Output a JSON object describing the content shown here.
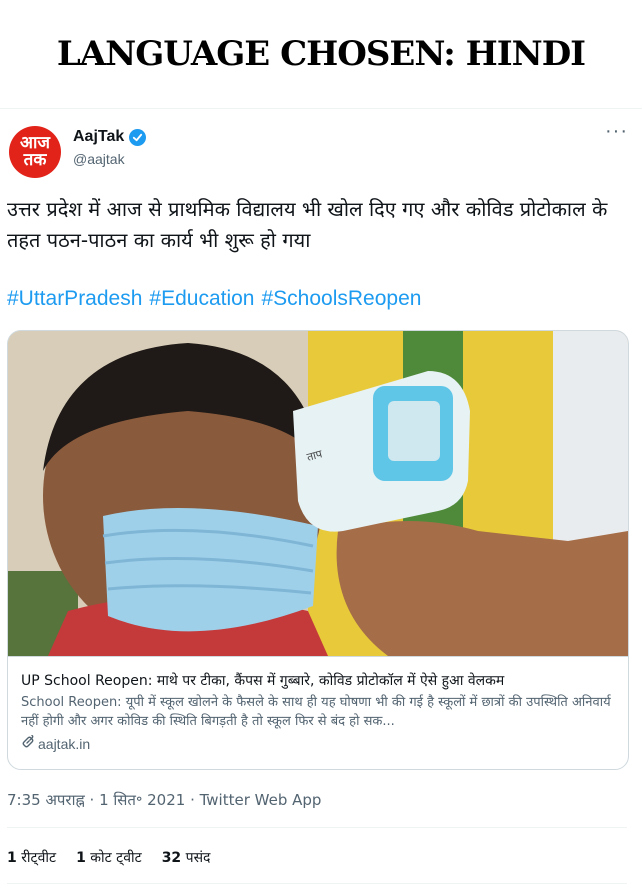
{
  "banner": {
    "title": "LANGUAGE CHOSEN: HINDI"
  },
  "author": {
    "avatar_text": "आज\nतक",
    "name": "AajTak",
    "handle": "@aajtak",
    "verified": true,
    "brand_color": "#e2231a"
  },
  "tweet": {
    "more_label": "···",
    "text": "उत्तर प्रदेश में आज से प्राथमिक विद्यालय भी खोल दिए गए और कोविड प्रोटोकाल के तहत पठन-पाठन का कार्य भी शुरू हो गया",
    "hashtags": [
      "#UttarPradesh",
      "#Education",
      "#SchoolsReopen"
    ],
    "timestamp": "7:35 अपराह्न · 1 सित॰ 2021 · Twitter Web App"
  },
  "card": {
    "image_description_icon": "photo-child-mask-thermometer",
    "title": "UP School Reopen: माथे पर टीका, कैंपस में गुब्बारे, कोविड प्रोटोकॉल में ऐसे हुआ वेलकम",
    "description": "School Reopen: यूपी में स्कूल खोलने के फैसले के साथ ही यह घोषणा भी की गई है स्कूलों में छात्रों की उपस्थिति अनिवार्य नहीं होगी और अगर कोविड की स्थिति बिगड़ती है तो स्कूल फिर से बंद हो सक...",
    "domain": "aajtak.in"
  },
  "stats": {
    "retweets": {
      "count": "1",
      "label": "रीट्वीट"
    },
    "quotes": {
      "count": "1",
      "label": "कोट ट्वीट"
    },
    "likes": {
      "count": "32",
      "label": "पसंद"
    }
  },
  "colors": {
    "link": "#1d9bf0",
    "secondary_text": "#536471",
    "border": "#cfd9de"
  }
}
